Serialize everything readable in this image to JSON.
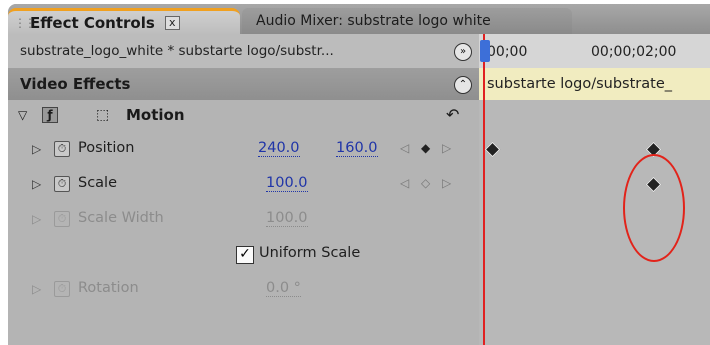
{
  "tabs": {
    "active_label": "Effect Controls",
    "active_close": "x",
    "inactive_label": "Audio Mixer: substrate  logo  white"
  },
  "sequence_label": "substrate_logo_white * substarte logo/substr...",
  "video_effects_label": "Video Effects",
  "motion_label": "Motion",
  "properties": [
    {
      "name": "Position",
      "value1": "240.0",
      "value2": "160.0"
    },
    {
      "name": "Scale",
      "value1": "100.0"
    },
    {
      "name": "Scale Width",
      "value1": "100.0"
    },
    {
      "name": "Rotation",
      "value1": "0.0 °"
    }
  ],
  "uniform_scale_label": "Uniform Scale",
  "timeline": {
    "time_start": "00;00",
    "time_mark": "00;00;02;00",
    "clip_name": "substarte logo/substrate_"
  },
  "colors": {
    "playhead": "#e02020",
    "highlight_ellipse": "#e2231a",
    "clip_bar": "#f1ecc0",
    "value_link": "#2035a8",
    "active_tab_accent": "#f0a020"
  }
}
